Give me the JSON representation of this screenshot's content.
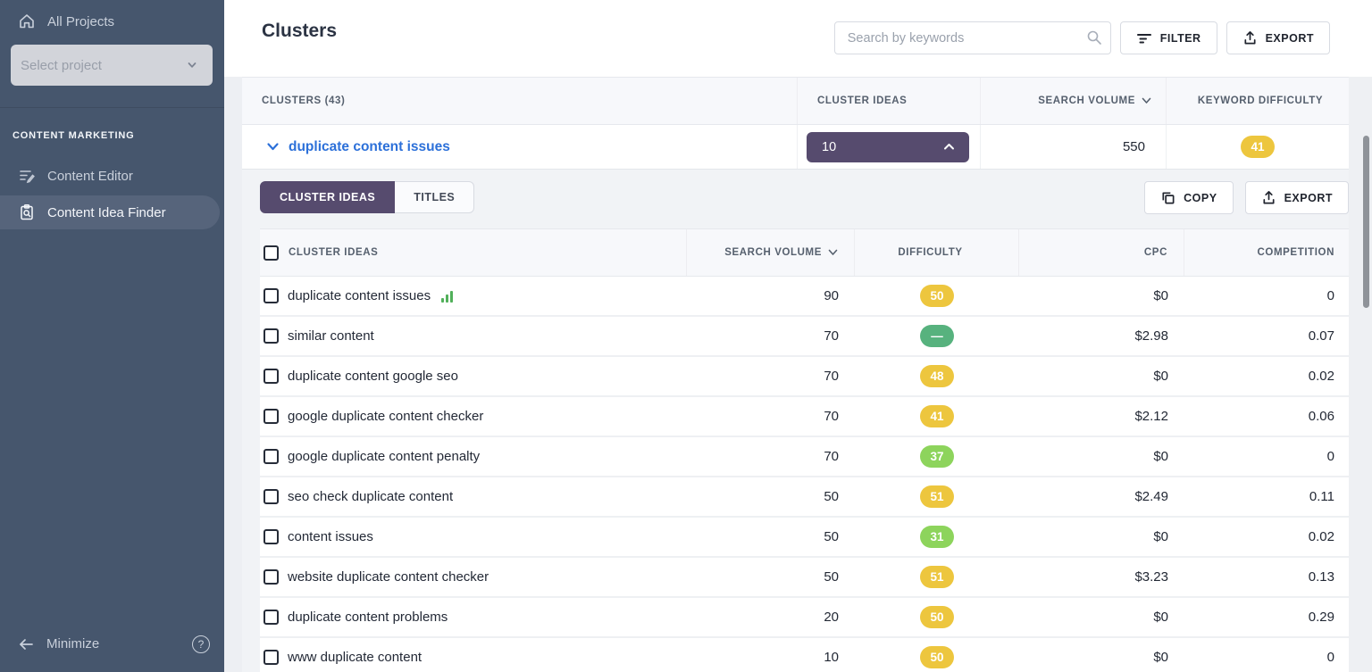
{
  "colors": {
    "sidebar_bg": "#46566d",
    "accent_purple": "#564b6e",
    "link_blue": "#2c70d9",
    "badge_yellow": "#edc63e",
    "badge_green": "#57b27e",
    "badge_lime": "#8dd45c"
  },
  "sidebar": {
    "all_projects_label": "All Projects",
    "project_select": {
      "placeholder": "Select project"
    },
    "section_title": "CONTENT MARKETING",
    "items": [
      {
        "label": "Content Editor"
      },
      {
        "label": "Content Idea Finder"
      }
    ],
    "minimize_label": "Minimize",
    "help_glyph": "?"
  },
  "header": {
    "title": "Clusters",
    "search_placeholder": "Search by keywords",
    "filter_label": "FILTER",
    "export_label": "EXPORT"
  },
  "clusters_table": {
    "headers": {
      "clusters": "CLUSTERS  (43)",
      "cluster_ideas": "CLUSTER IDEAS",
      "search_volume": "SEARCH VOLUME",
      "keyword_difficulty": "KEYWORD DIFFICULTY"
    },
    "expanded_row": {
      "name": "duplicate content issues",
      "cluster_ideas_count": "10",
      "search_volume": "550",
      "keyword_difficulty": "41",
      "difficulty_color": "yellow"
    }
  },
  "detail_panel": {
    "tabs": [
      {
        "label": "CLUSTER IDEAS",
        "active": true
      },
      {
        "label": "TITLES",
        "active": false
      }
    ],
    "copy_label": "COPY",
    "export_label": "EXPORT",
    "table": {
      "headers": {
        "keyword": "CLUSTER IDEAS",
        "volume": "SEARCH VOLUME",
        "difficulty": "DIFFICULTY",
        "cpc": "CPC",
        "competition": "COMPETITION"
      },
      "rows": [
        {
          "keyword": "duplicate content issues",
          "has_trend_icon": true,
          "volume": "90",
          "difficulty": "50",
          "difficulty_color": "yellow",
          "cpc": "$0",
          "competition": "0"
        },
        {
          "keyword": "similar content",
          "has_trend_icon": false,
          "volume": "70",
          "difficulty": "—",
          "difficulty_color": "green",
          "cpc": "$2.98",
          "competition": "0.07"
        },
        {
          "keyword": "duplicate content google seo",
          "has_trend_icon": false,
          "volume": "70",
          "difficulty": "48",
          "difficulty_color": "yellow",
          "cpc": "$0",
          "competition": "0.02"
        },
        {
          "keyword": "google duplicate content checker",
          "has_trend_icon": false,
          "volume": "70",
          "difficulty": "41",
          "difficulty_color": "yellow",
          "cpc": "$2.12",
          "competition": "0.06"
        },
        {
          "keyword": "google duplicate content penalty",
          "has_trend_icon": false,
          "volume": "70",
          "difficulty": "37",
          "difficulty_color": "lime",
          "cpc": "$0",
          "competition": "0"
        },
        {
          "keyword": "seo check duplicate content",
          "has_trend_icon": false,
          "volume": "50",
          "difficulty": "51",
          "difficulty_color": "yellow",
          "cpc": "$2.49",
          "competition": "0.11"
        },
        {
          "keyword": "content issues",
          "has_trend_icon": false,
          "volume": "50",
          "difficulty": "31",
          "difficulty_color": "lime",
          "cpc": "$0",
          "competition": "0.02"
        },
        {
          "keyword": "website duplicate content checker",
          "has_trend_icon": false,
          "volume": "50",
          "difficulty": "51",
          "difficulty_color": "yellow",
          "cpc": "$3.23",
          "competition": "0.13"
        },
        {
          "keyword": "duplicate content problems",
          "has_trend_icon": false,
          "volume": "20",
          "difficulty": "50",
          "difficulty_color": "yellow",
          "cpc": "$0",
          "competition": "0.29"
        },
        {
          "keyword": "www duplicate content",
          "has_trend_icon": false,
          "volume": "10",
          "difficulty": "50",
          "difficulty_color": "yellow",
          "cpc": "$0",
          "competition": "0"
        }
      ]
    }
  }
}
